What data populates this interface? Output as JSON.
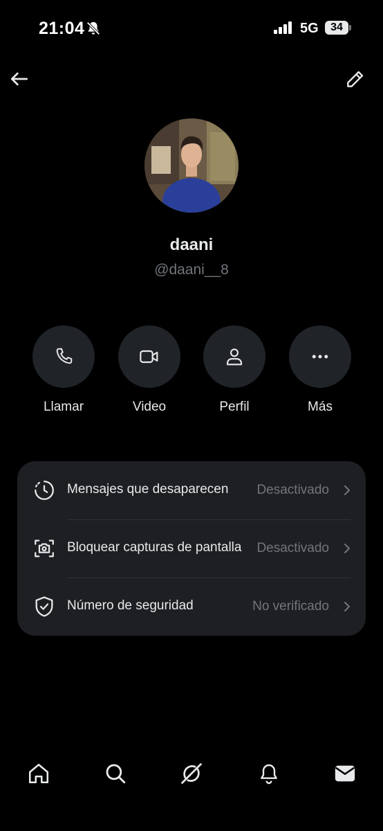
{
  "status_bar": {
    "time": "21:04",
    "network": "5G",
    "battery": "34"
  },
  "profile": {
    "name": "daani",
    "handle": "@daani__8"
  },
  "actions": [
    {
      "label": "Llamar",
      "icon": "phone-icon"
    },
    {
      "label": "Video",
      "icon": "video-icon"
    },
    {
      "label": "Perfil",
      "icon": "person-icon"
    },
    {
      "label": "Más",
      "icon": "more-icon"
    }
  ],
  "settings": [
    {
      "label": "Mensajes que desaparecen",
      "value": "Desactivado",
      "icon": "timer-icon"
    },
    {
      "label": "Bloquear capturas de pantalla",
      "value": "Desactivado",
      "icon": "screenshot-camera-icon"
    },
    {
      "label": "Número de seguridad",
      "value": "No verificado",
      "icon": "shield-check-icon"
    }
  ],
  "bottom_nav": [
    "home-icon",
    "search-icon",
    "grok-icon",
    "notifications-icon",
    "messages-icon"
  ],
  "colors": {
    "background": "#000000",
    "surface": "#1d1f23",
    "button": "#202327",
    "text": "#e7e9ea",
    "muted": "#71767b"
  }
}
